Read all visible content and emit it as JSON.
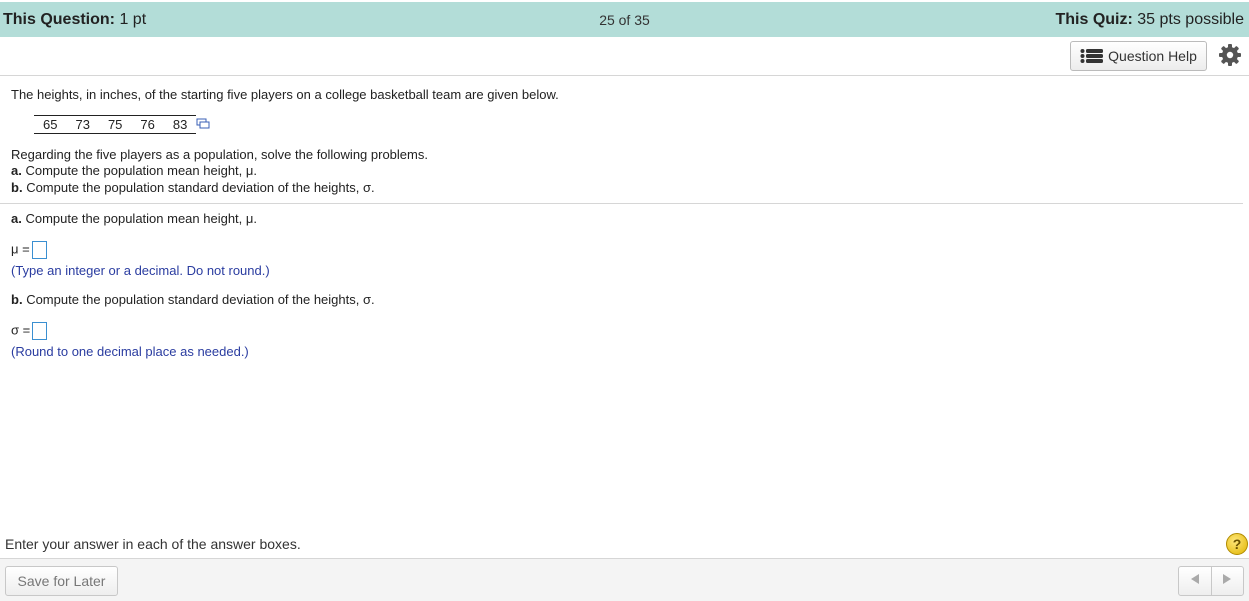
{
  "header": {
    "this_question_label": "This Question:",
    "this_question_value": "1 pt",
    "progress": "25 of 35",
    "this_quiz_label": "This Quiz:",
    "this_quiz_value": "35 pts possible"
  },
  "toolbar": {
    "question_help_label": "Question Help",
    "icons": [
      "list-icon",
      "gear-icon"
    ]
  },
  "question": {
    "intro": "The heights, in inches, of the starting five players on a college basketball team are given below.",
    "heights": [
      "65",
      "73",
      "75",
      "76",
      "83"
    ],
    "regarding": "Regarding the five players as a population, solve the following problems.",
    "part_a_label": "a.",
    "part_a_text": "Compute the population mean height, μ.",
    "part_b_label": "b.",
    "part_b_text": "Compute the population standard deviation of the heights, σ."
  },
  "answers": {
    "a_label": "a.",
    "a_text": "Compute the population mean height, μ.",
    "mu_prefix": "μ =",
    "mu_hint": "(Type an integer or a decimal. Do not round.)",
    "b_label": "b.",
    "b_text": "Compute the population standard deviation of the heights, σ.",
    "sigma_prefix": "σ =",
    "sigma_hint": "(Round to one decimal place as needed.)"
  },
  "footer": {
    "instruction": "Enter your answer in each of the answer boxes.",
    "help_symbol": "?",
    "save_label": "Save for Later"
  },
  "colors": {
    "header_bg": "#b3ddd8",
    "hint_text": "#2a3ca0",
    "answer_box_border": "#3a8fd1",
    "help_badge": "#f2c200"
  }
}
